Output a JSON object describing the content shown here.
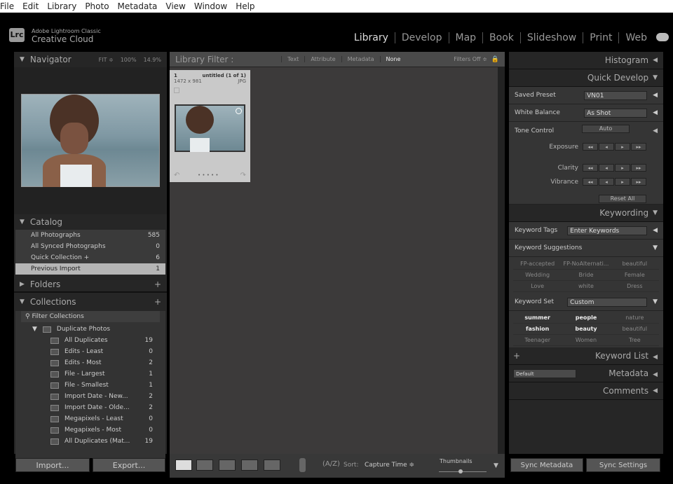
{
  "menu": [
    "File",
    "Edit",
    "Library",
    "Photo",
    "Metadata",
    "View",
    "Window",
    "Help"
  ],
  "brand": {
    "logo": "Lrc",
    "line1": "Adobe Lightroom Classic",
    "line2": "Creative Cloud"
  },
  "modules": [
    "Library",
    "Develop",
    "Map",
    "Book",
    "Slideshow",
    "Print",
    "Web"
  ],
  "navigator": {
    "title": "Navigator",
    "fit": "FIT ≑",
    "z1": "100%",
    "z2": "14.9%"
  },
  "catalog": {
    "title": "Catalog",
    "items": [
      {
        "label": "All Photographs",
        "count": "585"
      },
      {
        "label": "All Synced Photographs",
        "count": "0"
      },
      {
        "label": "Quick Collection +",
        "count": "6"
      },
      {
        "label": "Previous Import",
        "count": "1"
      }
    ]
  },
  "folders": {
    "title": "Folders"
  },
  "collections": {
    "title": "Collections",
    "filter": "Filter Collections",
    "set": "Duplicate Photos",
    "items": [
      {
        "label": "All Duplicates",
        "count": "19"
      },
      {
        "label": "Edits - Least",
        "count": "0"
      },
      {
        "label": "Edits - Most",
        "count": "2"
      },
      {
        "label": "File - Largest",
        "count": "1"
      },
      {
        "label": "File - Smallest",
        "count": "1"
      },
      {
        "label": "Import Date - New...",
        "count": "2"
      },
      {
        "label": "Import Date - Olde...",
        "count": "2"
      },
      {
        "label": "Megapixels - Least",
        "count": "0"
      },
      {
        "label": "Megapixels - Most",
        "count": "0"
      },
      {
        "label": "All Duplicates (Mat...",
        "count": "19"
      }
    ]
  },
  "left_buttons": {
    "import": "Import...",
    "export": "Export..."
  },
  "filter": {
    "title": "Library Filter :",
    "tabs": [
      "Text",
      "Attribute",
      "Metadata",
      "None"
    ],
    "status": "Filters Off ≑"
  },
  "thumb": {
    "index": "1",
    "name": "untitled (1 of 1)",
    "dims": "1472 x 981",
    "type": "JPG"
  },
  "toolbar": {
    "sort_label": "Sort:",
    "sort_value": "Capture Time ≑",
    "thumbnails": "Thumbnails",
    "thumb_size": 0.45
  },
  "right": {
    "histogram": "Histogram",
    "quick_develop": "Quick Develop",
    "saved_preset_label": "Saved Preset",
    "saved_preset": "VN01",
    "wb_label": "White Balance",
    "wb": "As Shot",
    "tone_label": "Tone Control",
    "auto": "Auto",
    "exposure": "Exposure",
    "clarity": "Clarity",
    "vibrance": "Vibrance",
    "reset": "Reset All",
    "keywording": "Keywording",
    "kw_tags_label": "Keyword Tags",
    "kw_tags": "Enter Keywords",
    "kw_sugg": "Keyword Suggestions",
    "suggestions": [
      "FP-accepted",
      "FP-NoAlternati...",
      "beautiful",
      "Wedding",
      "Bride",
      "Female",
      "Love",
      "white",
      "Dress"
    ],
    "kw_set_label": "Keyword Set",
    "kw_set": "Custom",
    "set_items": [
      {
        "t": "summer",
        "b": true
      },
      {
        "t": "people",
        "b": true
      },
      {
        "t": "nature",
        "b": false
      },
      {
        "t": "fashion",
        "b": true
      },
      {
        "t": "beauty",
        "b": true
      },
      {
        "t": "beautiful",
        "b": false
      },
      {
        "t": "Teenager",
        "b": false
      },
      {
        "t": "Women",
        "b": false
      },
      {
        "t": "Tree",
        "b": false
      }
    ],
    "keyword_list": "Keyword List",
    "metadata_preset": "Default",
    "metadata": "Metadata",
    "comments": "Comments",
    "sync_metadata": "Sync Metadata",
    "sync_settings": "Sync Settings"
  }
}
